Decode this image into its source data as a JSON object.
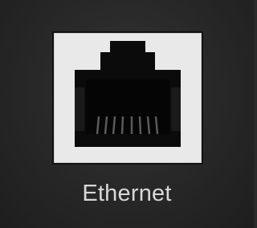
{
  "port": {
    "label": "Ethernet",
    "icon": "rj45-ethernet-port-icon"
  }
}
